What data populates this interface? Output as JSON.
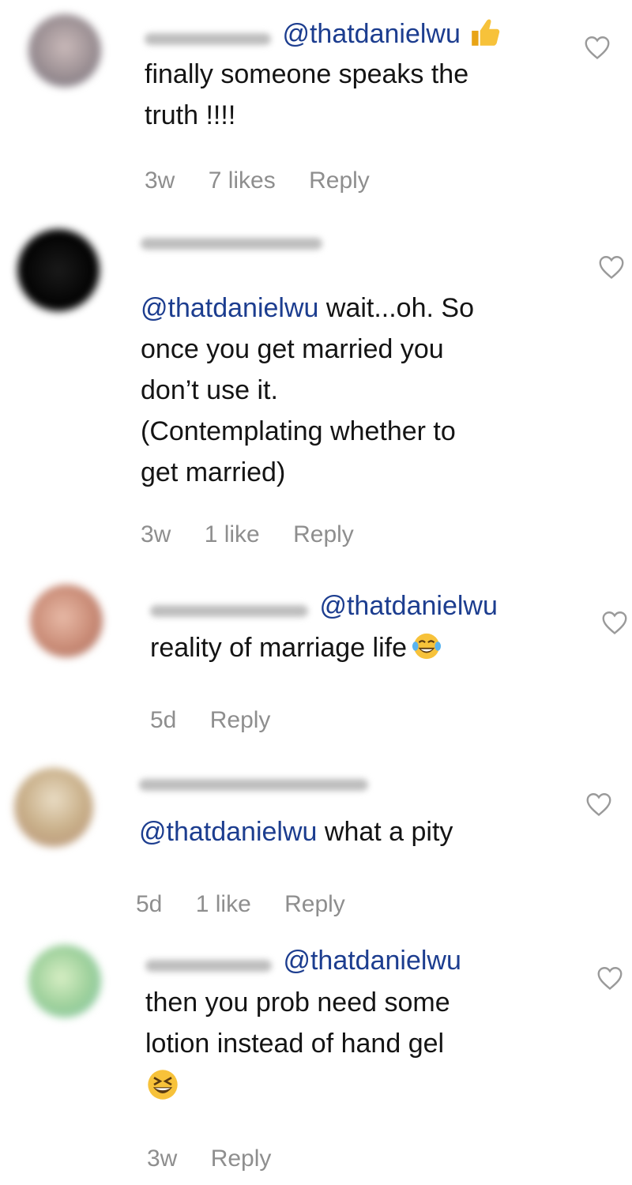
{
  "comments": [
    {
      "mention": "@thatdanielwu",
      "text": "finally someone speaks the\ntruth !!!!",
      "age": "3w",
      "likes": "7 likes",
      "reply": "Reply",
      "emoji": "thumbs-up-icon"
    },
    {
      "mention": "@thatdanielwu",
      "text": " wait...oh. So\nonce you get married you\ndon’t use it.\n(Contemplating whether to\nget married)",
      "age": "3w",
      "likes": "1 like",
      "reply": "Reply"
    },
    {
      "mention": "@thatdanielwu",
      "text": "reality of marriage life",
      "age": "5d",
      "reply": "Reply",
      "emoji": "tears-of-joy-icon"
    },
    {
      "mention": "@thatdanielwu",
      "text": " what a pity",
      "age": "5d",
      "likes": "1 like",
      "reply": "Reply"
    },
    {
      "mention": "@thatdanielwu",
      "text": "then you prob need some\nlotion instead of hand gel",
      "age": "3w",
      "reply": "Reply",
      "emoji": "grinning-squinting-icon"
    }
  ],
  "colors": {
    "mention": "#1c3d8f",
    "meta": "#8e8e8e",
    "text": "#141414"
  }
}
